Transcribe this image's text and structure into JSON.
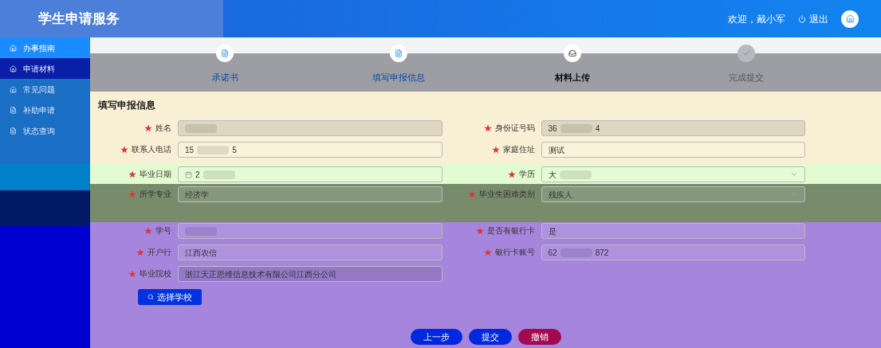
{
  "header": {
    "title": "学生申请服务",
    "welcome": "欢迎，戴小军",
    "logout": "退出"
  },
  "sidebar": {
    "items": [
      {
        "label": "办事指南",
        "selected": true
      },
      {
        "label": "申请材料",
        "selected": false
      },
      {
        "label": "常见问题",
        "selected": false
      },
      {
        "label": "补助申请",
        "selected": false
      },
      {
        "label": "状态查询",
        "selected": false
      }
    ]
  },
  "steps": [
    {
      "label": "承诺书",
      "done": true,
      "current": false
    },
    {
      "label": "填写申报信息",
      "done": true,
      "current": false
    },
    {
      "label": "材料上传",
      "done": false,
      "current": true
    },
    {
      "label": "完成提交",
      "done": false,
      "current": false
    }
  ],
  "form": {
    "title": "填写申报信息",
    "rows": [
      [
        {
          "label": "姓名",
          "kind": "text",
          "required": true,
          "masked": true,
          "disabled": true
        },
        {
          "label": "身份证号码",
          "kind": "text",
          "required": true,
          "prefix": "36",
          "suffix": "4",
          "masked": true,
          "disabled": true
        }
      ],
      [
        {
          "label": "联系人电话",
          "kind": "text",
          "required": true,
          "prefix": "15",
          "suffix": "5",
          "masked": true,
          "disabled": false
        },
        {
          "label": "家庭住址",
          "kind": "text",
          "required": true,
          "prefix": "测试",
          "masked": false,
          "disabled": false
        }
      ],
      [
        {
          "label": "毕业日期",
          "kind": "date",
          "required": true,
          "prefix": "2",
          "masked": true,
          "disabled": false
        },
        {
          "label": "学历",
          "kind": "select",
          "required": true,
          "prefix": "大",
          "masked": true,
          "disabled": false
        }
      ],
      [
        {
          "label": "所学专业",
          "kind": "select",
          "required": true,
          "prefix": "经济学",
          "masked": false,
          "disabled": false
        },
        {
          "label": "毕业生困难类别",
          "kind": "select",
          "required": true,
          "prefix": "残疾人",
          "masked": false,
          "disabled": false
        }
      ],
      [
        {
          "label": "学号",
          "kind": "text",
          "required": true,
          "masked": true,
          "disabled": false
        },
        {
          "label": "是否有银行卡",
          "kind": "select",
          "required": true,
          "prefix": "是",
          "masked": false,
          "disabled": false
        }
      ],
      [
        {
          "label": "开户行",
          "kind": "text",
          "required": true,
          "prefix": "江西农信",
          "masked": false,
          "disabled": false
        },
        {
          "label": "银行卡账号",
          "kind": "text",
          "required": true,
          "prefix": "62",
          "suffix": "872",
          "masked": true,
          "disabled": false
        }
      ],
      [
        {
          "label": "毕业院校",
          "kind": "text",
          "required": true,
          "prefix": "浙江天正思维信息技术有限公司江西分公司",
          "masked": false,
          "disabled": true
        }
      ]
    ],
    "choose_button": "选择学校"
  },
  "buttons": [
    {
      "label": "上一步",
      "kind": "primary"
    },
    {
      "label": "提交",
      "kind": "primary"
    },
    {
      "label": "撤销",
      "kind": "danger"
    }
  ]
}
